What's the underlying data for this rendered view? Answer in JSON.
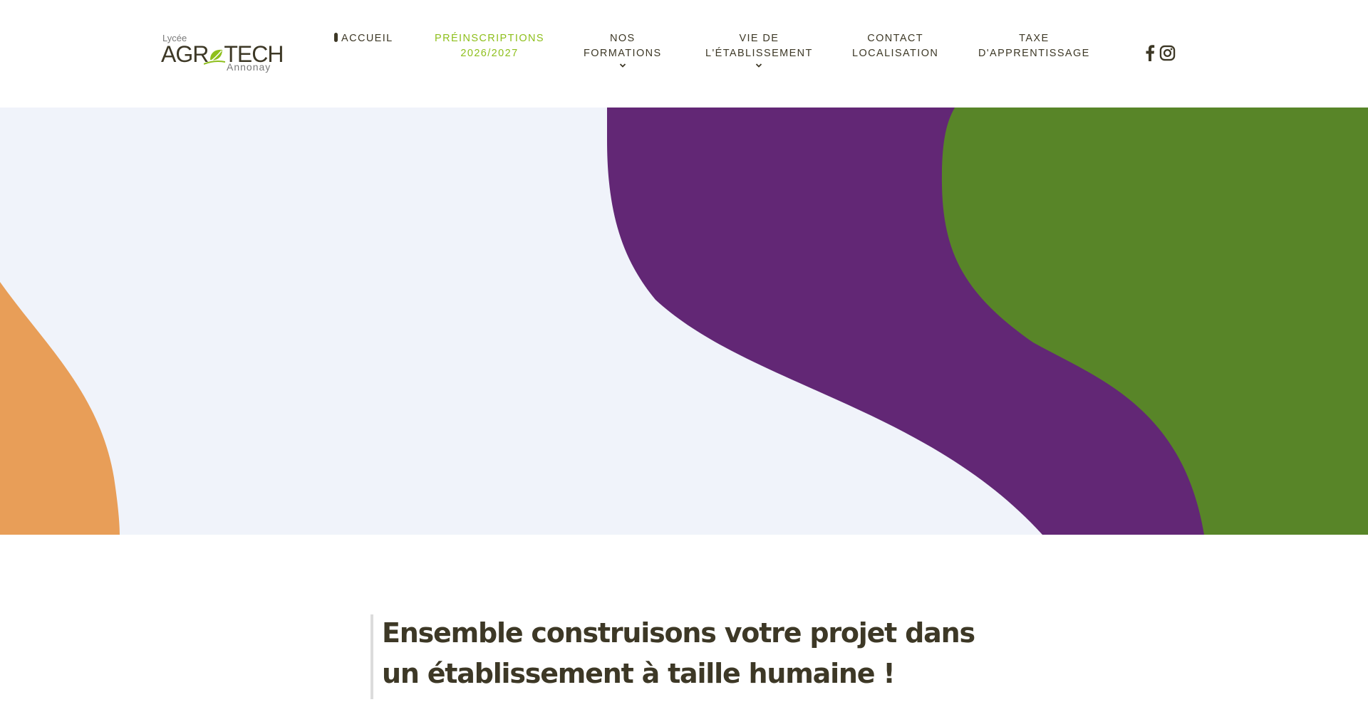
{
  "logo": {
    "lycee": "Lycée",
    "main_before": "AGR",
    "main_after": "TECH",
    "city": "Annonay",
    "leaf_icon": "leaf-icon"
  },
  "nav": {
    "accueil": "Accueil",
    "preinscriptions": [
      "PRÉINSCRIPTIONS",
      "2026/2027"
    ],
    "formations": [
      "NOS",
      "FORMATIONS"
    ],
    "vie": [
      "VIE DE",
      "L'ÉTABLISSEMENT"
    ],
    "contact": [
      "CONTACT",
      "LOCALISATION"
    ],
    "taxe": [
      "TAXE",
      "D'APPRENTISSAGE"
    ]
  },
  "social": {
    "facebook_icon": "facebook-icon",
    "instagram_icon": "instagram-icon"
  },
  "hero": {
    "colors": {
      "background": "#f0f3fa",
      "orange": "#e89e58",
      "purple": "#622775",
      "green": "#588528"
    }
  },
  "content": {
    "headline_line1": "Ensemble construisons votre projet dans",
    "headline_line2": "un établissement à taille humaine !"
  },
  "colors": {
    "text_dark": "#3d3826",
    "accent_green": "#8ebf1c"
  }
}
